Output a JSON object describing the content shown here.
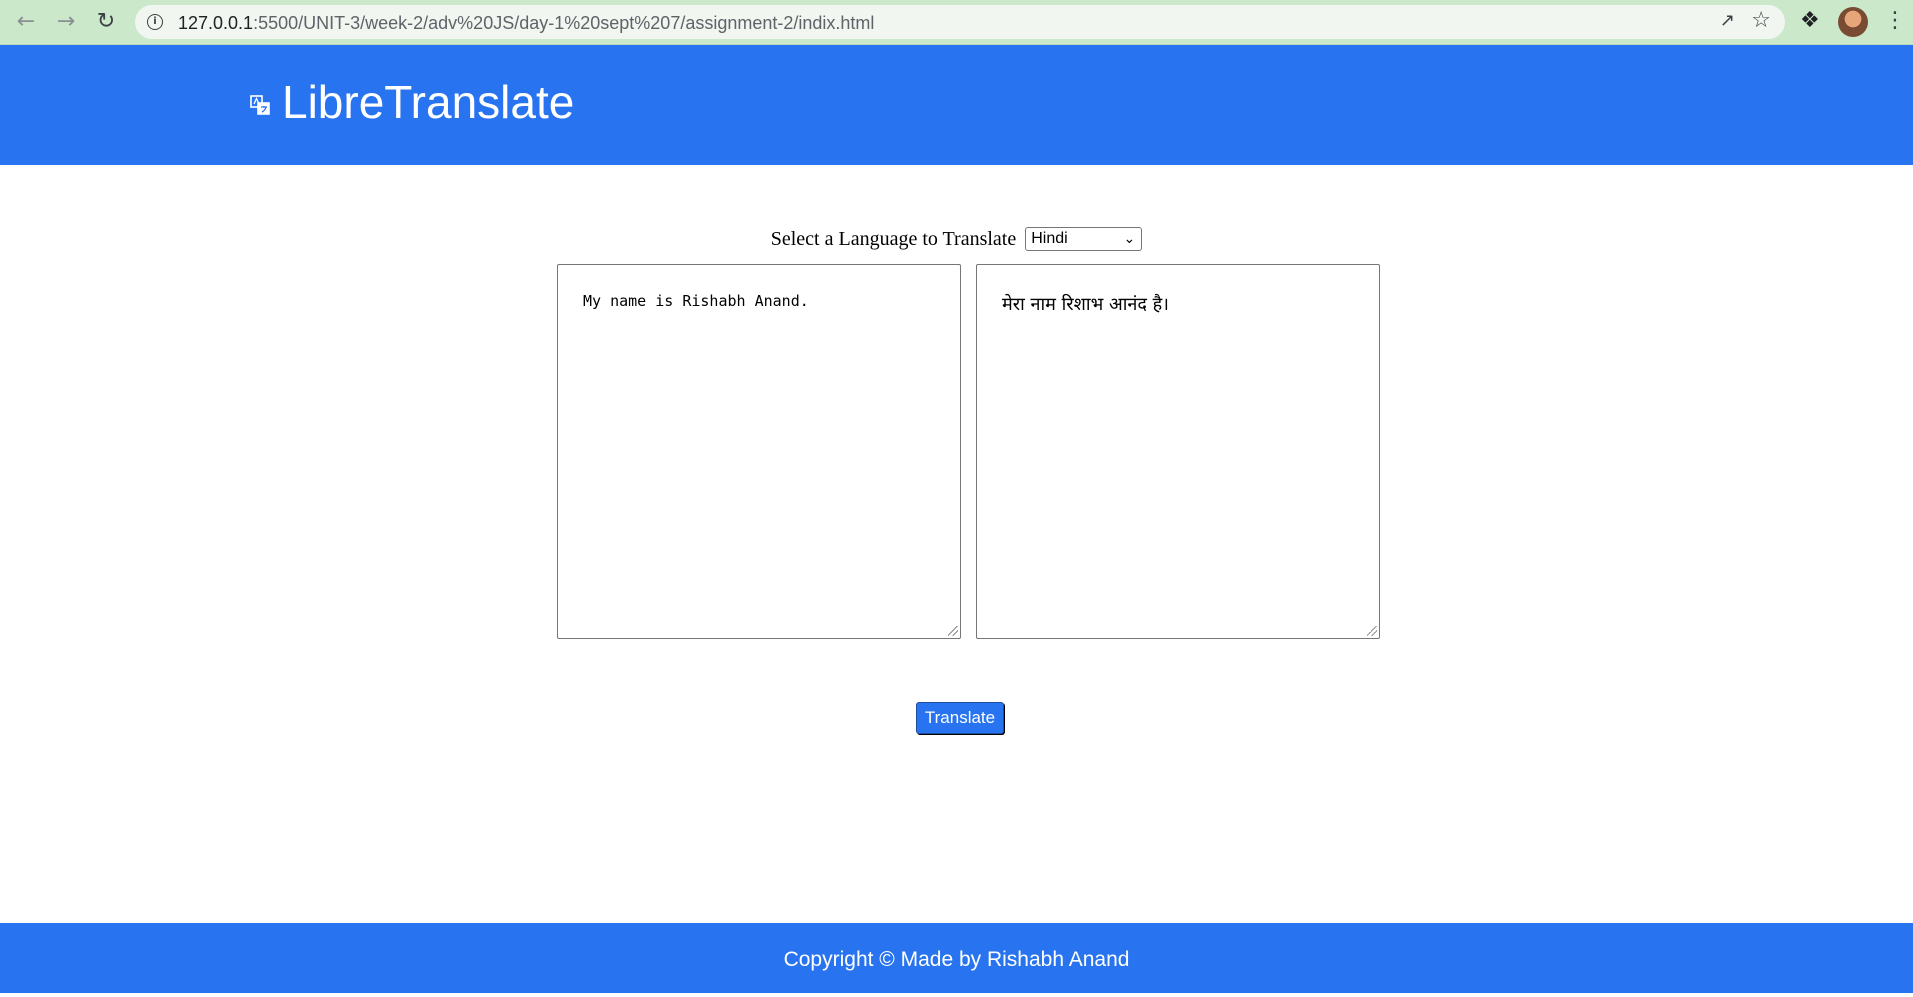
{
  "browser": {
    "url_host": "127.0.0.1",
    "url_path": ":5500/UNIT-3/week-2/adv%20JS/day-1%20sept%207/assignment-2/indix.html",
    "back_icon": "arrow-left-icon",
    "forward_icon": "arrow-right-icon",
    "reload_icon": "reload-icon"
  },
  "header": {
    "brand": "LibreTranslate",
    "logo_icon": "translate-icon",
    "color": "#2874f0"
  },
  "controls": {
    "language_label": "Select a Language to Translate",
    "language_selected": "Hindi",
    "source_text": "My name is Rishabh Anand.",
    "translated_text": "मेरा नाम रिशाभ आनंद है।",
    "translate_button": "Translate"
  },
  "footer": {
    "text": "Copyright © Made by Rishabh Anand"
  }
}
